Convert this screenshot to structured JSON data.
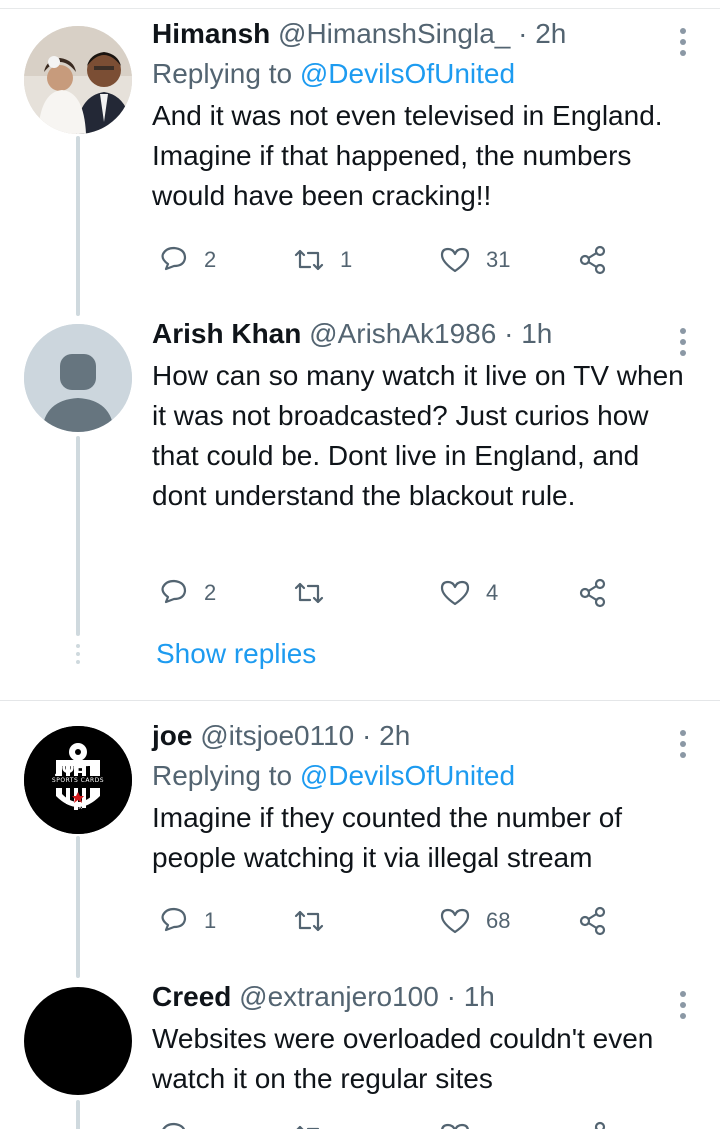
{
  "tweets": [
    {
      "name": "Himansh",
      "handle": "@HimanshSingla_",
      "sep": "·",
      "time": "2h",
      "replying_prefix": "Replying to",
      "replying_to": "@DevilsOfUnited",
      "text": "And it was not even televised in England. Imagine if that happened, the numbers would have been cracking!!",
      "reply_count": "2",
      "retweet_count": "1",
      "like_count": "31",
      "avatar": "photo-avatar"
    },
    {
      "name": "Arish Khan",
      "handle": "@ArishAk1986",
      "sep": "·",
      "time": "1h",
      "text": "How can so many watch it live on TV when it was not broadcasted? Just curios how that could be. Dont live in England, and dont understand the blackout rule.",
      "reply_count": "2",
      "retweet_count": "",
      "like_count": "4",
      "avatar": "default-avatar"
    },
    {
      "name": "joe",
      "handle": "@itsjoe0110",
      "sep": "·",
      "time": "2h",
      "replying_prefix": "Replying to",
      "replying_to": "@DevilsOfUnited",
      "text": "Imagine if they counted the number of people watching it via illegal stream",
      "reply_count": "1",
      "retweet_count": "",
      "like_count": "68",
      "avatar": "logo-avatar",
      "logo_text": "JOE'S",
      "logo_sub": "SPORTS CARDS",
      "logo_tag": "UK"
    },
    {
      "name": "Creed",
      "handle": "@extranjero100",
      "sep": "·",
      "time": "1h",
      "text": "Websites were overloaded couldn't even watch it on the regular sites",
      "avatar": "black-avatar"
    }
  ],
  "show_replies": "Show replies",
  "icons": {
    "reply": "reply-icon",
    "retweet": "retweet-icon",
    "like": "heart-icon",
    "share": "share-icon",
    "more": "more-icon"
  },
  "colors": {
    "link": "#1d9bf0",
    "secondary": "#536471",
    "thread_line": "#cfd9de"
  }
}
